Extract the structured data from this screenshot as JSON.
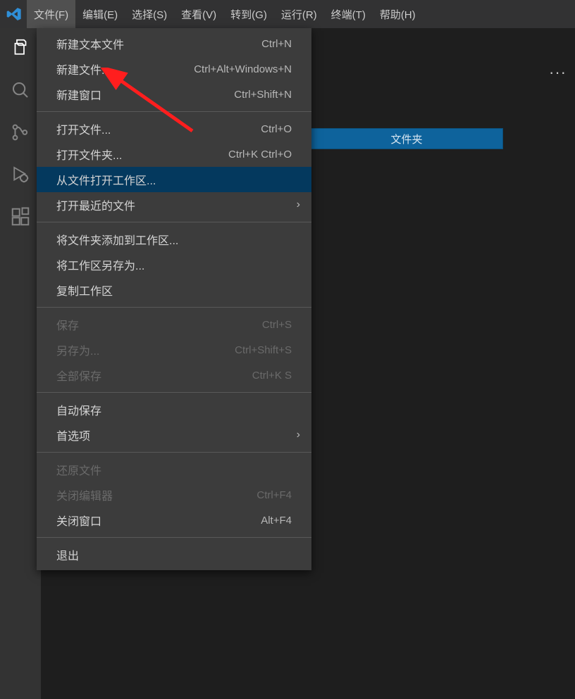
{
  "menubar": [
    "文件(F)",
    "编辑(E)",
    "选择(S)",
    "查看(V)",
    "转到(G)",
    "运行(R)",
    "终端(T)",
    "帮助(H)"
  ],
  "bg_button": "文件夹",
  "dots": "···",
  "file_menu": {
    "groups": [
      [
        {
          "label": "新建文本文件",
          "shortcut": "Ctrl+N"
        },
        {
          "label": "新建文件...",
          "shortcut": "Ctrl+Alt+Windows+N"
        },
        {
          "label": "新建窗口",
          "shortcut": "Ctrl+Shift+N"
        }
      ],
      [
        {
          "label": "打开文件...",
          "shortcut": "Ctrl+O"
        },
        {
          "label": "打开文件夹...",
          "shortcut": "Ctrl+K Ctrl+O"
        },
        {
          "label": "从文件打开工作区...",
          "shortcut": "",
          "hover": true
        },
        {
          "label": "打开最近的文件",
          "shortcut": "",
          "submenu": true
        }
      ],
      [
        {
          "label": "将文件夹添加到工作区...",
          "shortcut": ""
        },
        {
          "label": "将工作区另存为...",
          "shortcut": ""
        },
        {
          "label": "复制工作区",
          "shortcut": ""
        }
      ],
      [
        {
          "label": "保存",
          "shortcut": "Ctrl+S",
          "disabled": true
        },
        {
          "label": "另存为...",
          "shortcut": "Ctrl+Shift+S",
          "disabled": true
        },
        {
          "label": "全部保存",
          "shortcut": "Ctrl+K S",
          "disabled": true
        }
      ],
      [
        {
          "label": "自动保存",
          "shortcut": ""
        },
        {
          "label": "首选项",
          "shortcut": "",
          "submenu": true
        }
      ],
      [
        {
          "label": "还原文件",
          "shortcut": "",
          "disabled": true
        },
        {
          "label": "关闭编辑器",
          "shortcut": "Ctrl+F4",
          "disabled": true
        },
        {
          "label": "关闭窗口",
          "shortcut": "Alt+F4"
        }
      ],
      [
        {
          "label": "退出",
          "shortcut": ""
        }
      ]
    ]
  }
}
